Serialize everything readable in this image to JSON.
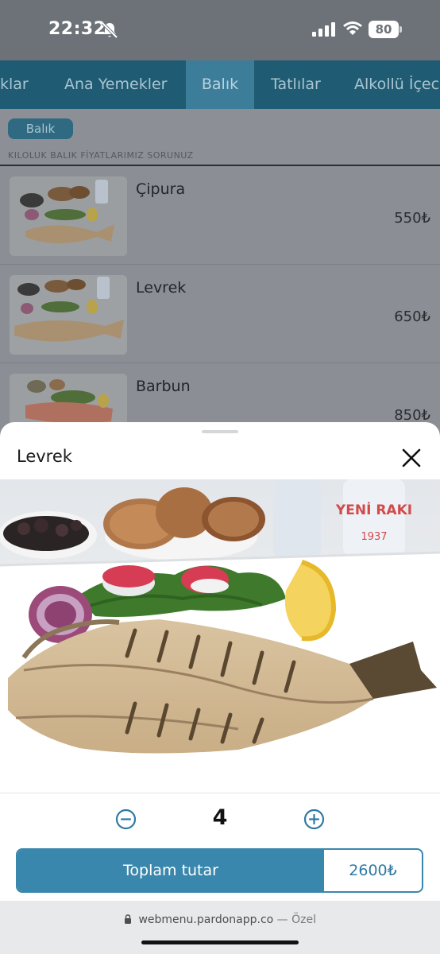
{
  "status_bar": {
    "time": "22:32",
    "battery": "80"
  },
  "tabs": [
    {
      "label": "klar"
    },
    {
      "label": "Ana Yemekler"
    },
    {
      "label": "Balık"
    },
    {
      "label": "Tatlılar"
    },
    {
      "label": "Alkollü İçece"
    }
  ],
  "subbar": {
    "chip": "Balık",
    "subtext": "KILOLUK BALIK FİYATLARIMIZ SORUNUZ"
  },
  "menu_items": [
    {
      "name": "Çipura",
      "price": "550₺"
    },
    {
      "name": "Levrek",
      "price": "650₺"
    },
    {
      "name": "Barbun",
      "price": "850₺"
    }
  ],
  "sheet": {
    "title": "Levrek",
    "quantity": "4",
    "total_label": "Toplam tutar",
    "total_price": "2600₺",
    "bottle_text": "YENİ RAKI",
    "bottle_year": "1937"
  },
  "browser": {
    "url": "webmenu.pardonapp.co",
    "separator": "—",
    "mode": "Özel"
  },
  "colors": {
    "brand": "#3a87ad",
    "tab_bar": "#1f5b73"
  },
  "icons": [
    "bell-slash-icon",
    "signal-icon",
    "wifi-icon",
    "battery-icon",
    "close-icon",
    "minus-circle-icon",
    "plus-circle-icon",
    "lock-icon"
  ]
}
